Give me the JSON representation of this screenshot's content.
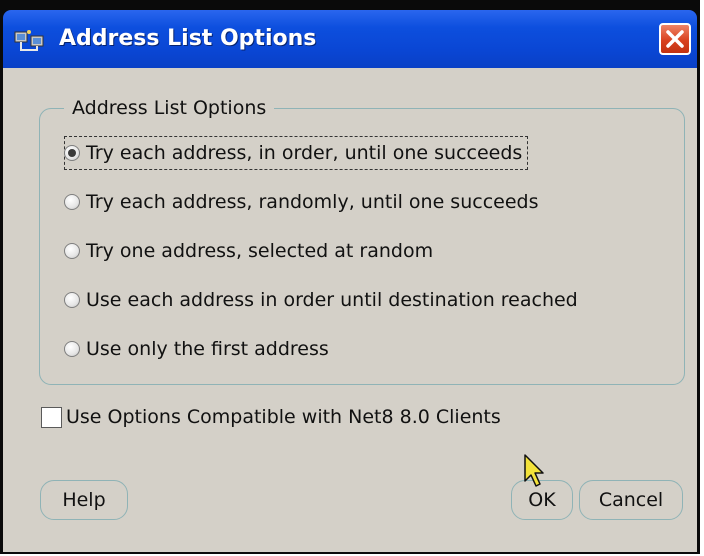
{
  "window": {
    "title": "Address List Options",
    "title_color": "#ffffff",
    "titlebar_color": "#0a46d4",
    "close_color": "#d9421f"
  },
  "group": {
    "legend": "Address List Options",
    "options": [
      {
        "label": "Try each address, in order, until one succeeds",
        "selected": true
      },
      {
        "label": "Try each address, randomly, until one succeeds",
        "selected": false
      },
      {
        "label": "Try one address, selected at random",
        "selected": false
      },
      {
        "label": "Use each address in order until destination reached",
        "selected": false
      },
      {
        "label": "Use only the first address",
        "selected": false
      }
    ]
  },
  "compat_checkbox": {
    "label": "Use Options Compatible with Net8 8.0 Clients",
    "checked": false
  },
  "buttons": {
    "help": "Help",
    "ok": "OK",
    "cancel": "Cancel"
  },
  "icons": [
    "app-icon",
    "close-icon",
    "mouse-cursor-icon"
  ]
}
